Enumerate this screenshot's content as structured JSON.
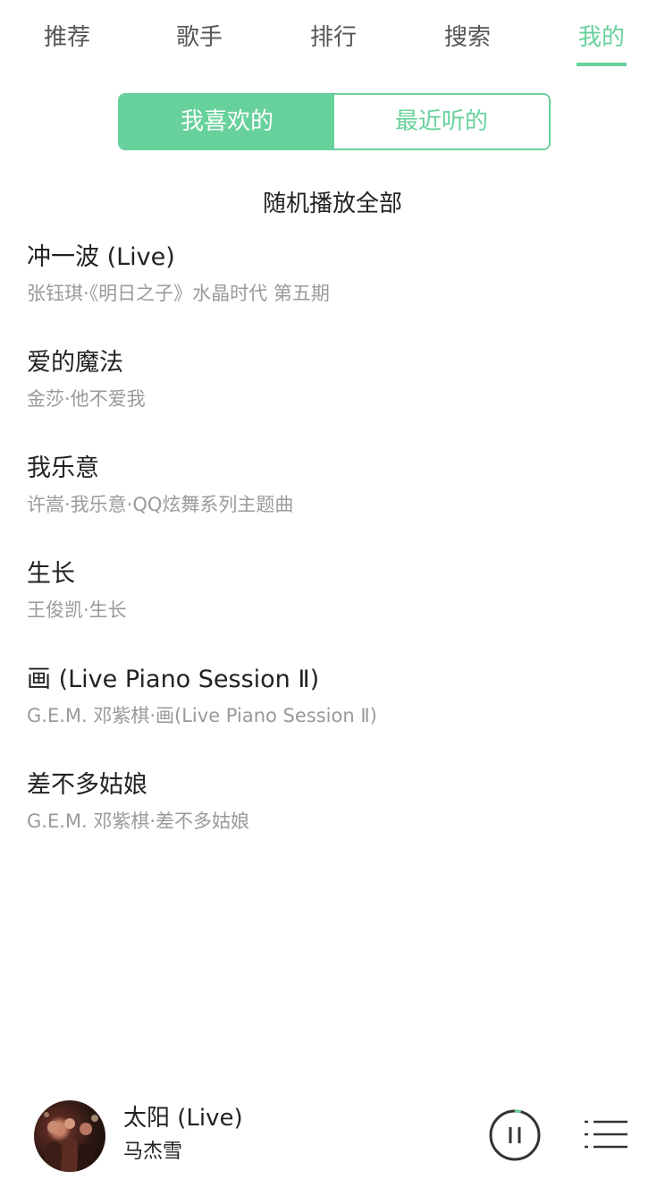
{
  "nav": {
    "tabs": [
      {
        "label": "推荐"
      },
      {
        "label": "歌手"
      },
      {
        "label": "排行"
      },
      {
        "label": "搜索"
      },
      {
        "label": "我的"
      }
    ],
    "active_tab": "我的"
  },
  "switch": {
    "liked_label": "我喜欢的",
    "recent_label": "最近听的",
    "active": "我喜欢的"
  },
  "shuffle_label": "随机播放全部",
  "songs": [
    {
      "title": "冲一波 (Live)",
      "subtitle": "张钰琪·《明日之子》水晶时代 第五期"
    },
    {
      "title": "爱的魔法",
      "subtitle": "金莎·他不爱我"
    },
    {
      "title": "我乐意",
      "subtitle": "许嵩·我乐意·QQ炫舞系列主题曲"
    },
    {
      "title": "生长",
      "subtitle": "王俊凯·生长"
    },
    {
      "title": "画 (Live Piano Session Ⅱ)",
      "subtitle": "G.E.M. 邓紫棋·画(Live Piano Session Ⅱ)"
    },
    {
      "title": "差不多姑娘",
      "subtitle": "G.E.M. 邓紫棋·差不多姑娘"
    }
  ],
  "player": {
    "title": "太阳 (Live)",
    "artist": "马杰雪",
    "progress": 0.04,
    "state_icon": "pause-icon",
    "playlist_icon": "playlist-icon"
  },
  "colors": {
    "accent": "#67d19c",
    "text": "#222222",
    "subtext": "#9a9a9a",
    "nav_inactive": "#555555"
  }
}
